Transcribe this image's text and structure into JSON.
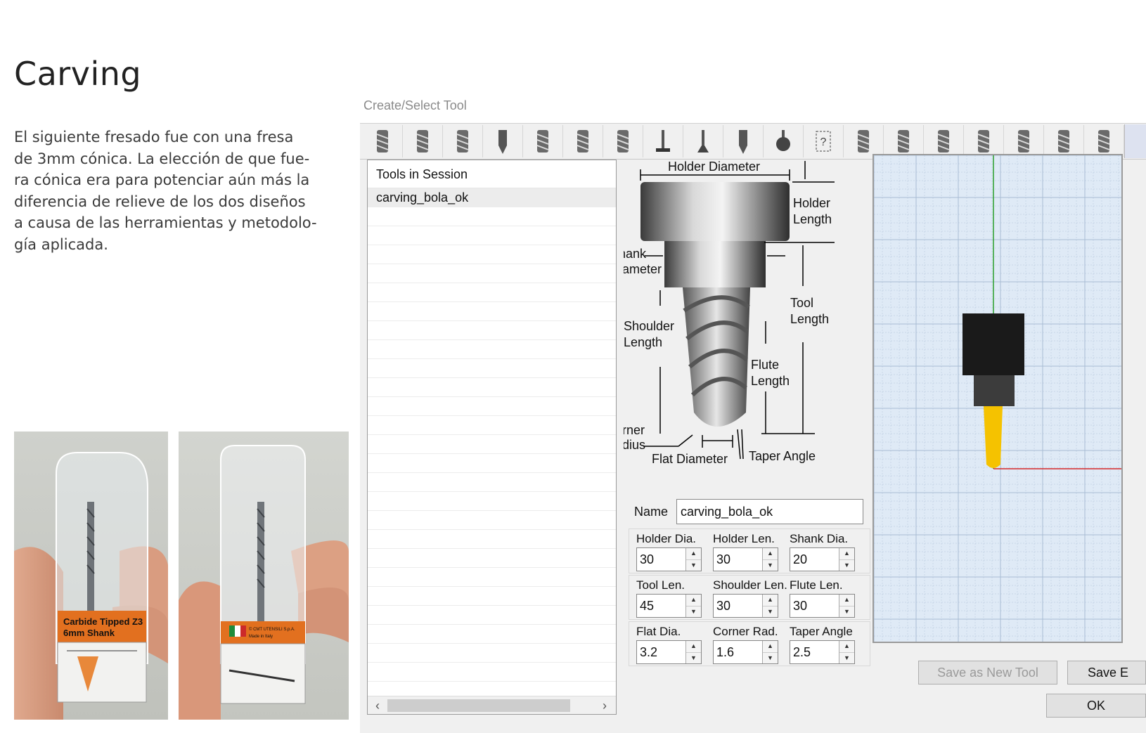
{
  "page": {
    "title": "Carving",
    "description": "El siguiente fresado fue con una fresa\nde 3mm cónica. La elección de que fue-\nra cónica era para potenciar aún más la\ndiferencia de relieve de los dos diseños\na causa de las herramientas y metodolo-\ngía aplicada."
  },
  "photos": {
    "left_label": "Carbide Tipped Z3\n6mm Shank",
    "left_label_line1": "Carbide Tipped Z3",
    "left_label_line2": "6mm Shank",
    "right_label_line1": "© CMT UTENSILI S.p.A.",
    "right_label_line2": "Made in Italy"
  },
  "dialog": {
    "title": "Create/Select Tool",
    "toolbar_icons": [
      "endmill-flat-icon",
      "endmill-ball-icon",
      "endmill-bull-icon",
      "engraving-icon",
      "taper-endmill-icon",
      "taper-ball-icon",
      "thread-mill-icon",
      "slot-cutter-icon",
      "dovetail-icon",
      "chamfer-icon",
      "lollipop-icon",
      "custom-tool-icon",
      "drill-icon",
      "spot-drill-icon",
      "reamer-icon",
      "tap-icon",
      "boring-icon",
      "countersink-icon",
      "counterbore-icon"
    ],
    "session": {
      "header": "Tools in Session",
      "items": [
        "carving_bola_ok"
      ]
    },
    "diagram_labels": {
      "holder_diameter": "Holder Diameter",
      "holder_length_1": "Holder",
      "holder_length_2": "Length",
      "shank_diameter_1": "Shank",
      "shank_diameter_2": "Diameter",
      "tool_length_1": "Tool",
      "tool_length_2": "Length",
      "shoulder_length_1": "Shoulder",
      "shoulder_length_2": "Length",
      "flute_length_1": "Flute",
      "flute_length_2": "Length",
      "corner_radius_1": "Corner",
      "corner_radius_2": "Radius",
      "flat_diameter": "Flat Diameter",
      "taper_angle": "Taper Angle"
    },
    "name_label": "Name",
    "name_value": "carving_bola_ok",
    "params": {
      "holder_dia": {
        "label": "Holder Dia.",
        "value": "30"
      },
      "holder_len": {
        "label": "Holder Len.",
        "value": "30"
      },
      "shank_dia": {
        "label": "Shank Dia.",
        "value": "20"
      },
      "tool_len": {
        "label": "Tool Len.",
        "value": "45"
      },
      "shoulder_len": {
        "label": "Shoulder Len.",
        "value": "30"
      },
      "flute_len": {
        "label": "Flute Len.",
        "value": "30"
      },
      "flat_dia": {
        "label": "Flat Dia.",
        "value": "3.2"
      },
      "corner_rad": {
        "label": "Corner Rad.",
        "value": "1.6"
      },
      "taper_angle": {
        "label": "Taper Angle",
        "value": "2.5"
      }
    },
    "buttons": {
      "save_new": "Save as New Tool",
      "save_edit": "Save E",
      "ok": "OK"
    },
    "colors": {
      "preview_bg": "#dfeaf6",
      "grid": "#a8bcd4",
      "holder": "#1a1a1a",
      "shank": "#3c3c3c",
      "flute": "#f5c200",
      "axis_y": "#2ca02c",
      "axis_x": "#d62728"
    }
  }
}
